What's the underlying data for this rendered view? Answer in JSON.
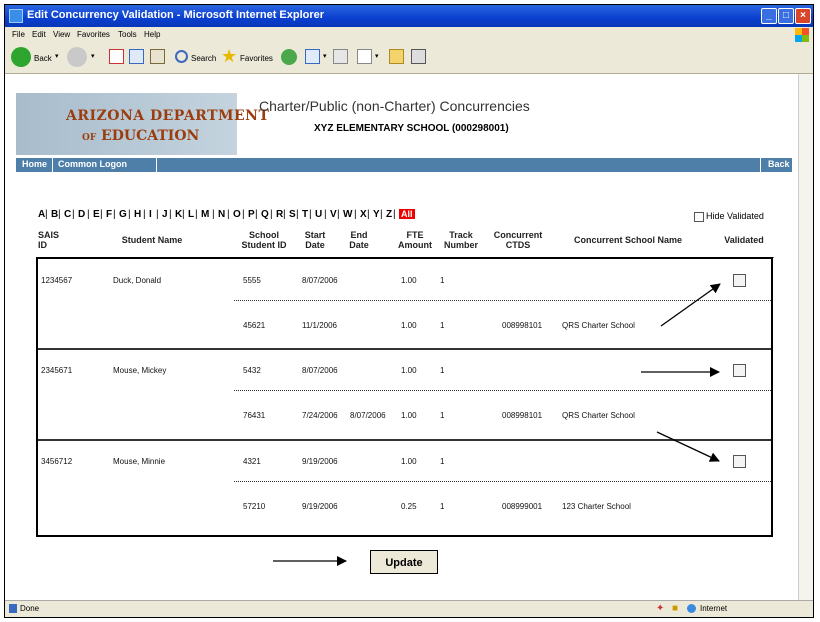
{
  "window": {
    "title": "Edit Concurrency Validation - Microsoft Internet Explorer"
  },
  "menu": {
    "items": [
      "File",
      "Edit",
      "View",
      "Favorites",
      "Tools",
      "Help"
    ]
  },
  "toolbar": {
    "back_label": "Back",
    "search_label": "Search",
    "favorites_label": "Favorites"
  },
  "header": {
    "logo_line1": "ARIZONA DEPARTMENT",
    "logo_of": "OF",
    "logo_line2": "EDUCATION",
    "page_title": "Charter/Public (non-Charter) Concurrencies",
    "school_name": "XYZ ELEMENTARY SCHOOL (000298001)"
  },
  "nav": {
    "home": "Home",
    "common_logon": "Common Logon",
    "back": "Back"
  },
  "alphabet": [
    "A",
    "B",
    "C",
    "D",
    "E",
    "F",
    "G",
    "H",
    "I",
    "J",
    "K",
    "L",
    "M",
    "N",
    "O",
    "P",
    "Q",
    "R",
    "S",
    "T",
    "U",
    "V",
    "W",
    "X",
    "Y",
    "Z"
  ],
  "alpha_sep": "|",
  "all_label": "All",
  "hide_validated_label": "Hide Validated",
  "columns": {
    "sais_1": "SAIS",
    "sais_2": "ID",
    "student_name": "Student Name",
    "school_1": "School",
    "school_2": "Student ID",
    "start_1": "Start",
    "start_2": "Date",
    "end_1": "End",
    "end_2": "Date",
    "fte_1": "FTE",
    "fte_2": "Amount",
    "track_1": "Track",
    "track_2": "Number",
    "cctds_1": "Concurrent",
    "cctds_2": "CTDS",
    "school_name": "Concurrent School Name",
    "validated": "Validated"
  },
  "students": [
    {
      "sais": "1234567",
      "name": "Duck, Donald",
      "primary": {
        "school_student_id": "5555",
        "start": "8/07/2006",
        "end": "",
        "fte": "1.00",
        "track": "1"
      },
      "concurrent": {
        "school_student_id": "45621",
        "start": "11/1/2006",
        "end": "",
        "fte": "1.00",
        "track": "1",
        "ctds": "008998101",
        "school_name": "QRS Charter School"
      }
    },
    {
      "sais": "2345671",
      "name": "Mouse, Mickey",
      "primary": {
        "school_student_id": "5432",
        "start": "8/07/2006",
        "end": "",
        "fte": "1.00",
        "track": "1"
      },
      "concurrent": {
        "school_student_id": "76431",
        "start": "7/24/2006",
        "end": "8/07/2006",
        "fte": "1.00",
        "track": "1",
        "ctds": "008998101",
        "school_name": "QRS Charter School"
      }
    },
    {
      "sais": "3456712",
      "name": "Mouse, Minnie",
      "primary": {
        "school_student_id": "4321",
        "start": "9/19/2006",
        "end": "",
        "fte": "1.00",
        "track": "1"
      },
      "concurrent": {
        "school_student_id": "57210",
        "start": "9/19/2006",
        "end": "",
        "fte": "0.25",
        "track": "1",
        "ctds": "008999001",
        "school_name": "123 Charter School"
      }
    }
  ],
  "update_label": "Update",
  "status": {
    "left": "Done",
    "zone": "Internet"
  }
}
